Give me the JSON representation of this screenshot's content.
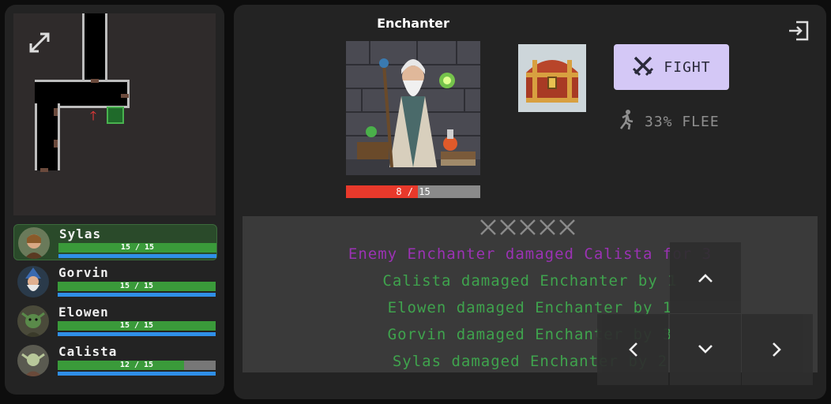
{
  "map": {
    "expand_icon": "expand-arrows-icon",
    "player_icon": "red-arrow-up-icon",
    "exit_icon": "green-square-icon"
  },
  "party": [
    {
      "name": "Sylas",
      "hp": 15,
      "max_hp": 15,
      "hp_text": "15 / 15",
      "active": true,
      "avatar": "elf-ranger"
    },
    {
      "name": "Gorvin",
      "hp": 15,
      "max_hp": 15,
      "hp_text": "15 / 15",
      "active": false,
      "avatar": "gnome-wizard"
    },
    {
      "name": "Elowen",
      "hp": 15,
      "max_hp": 15,
      "hp_text": "15 / 15",
      "active": false,
      "avatar": "lizardfolk"
    },
    {
      "name": "Calista",
      "hp": 12,
      "max_hp": 15,
      "hp_text": "12 / 15",
      "active": false,
      "avatar": "elf-cleric"
    }
  ],
  "enemy": {
    "name": "Enchanter",
    "hp": 8,
    "max_hp": 15,
    "hp_current": "8",
    "hp_sep": " / ",
    "hp_max": "15",
    "portrait": "old-wizard-with-potions"
  },
  "loot": {
    "icon": "treasure-chest-icon"
  },
  "actions": {
    "fight_label": "FIGHT",
    "fight_icon": "crossed-swords-icon",
    "flee_label": "33% FLEE",
    "flee_icon": "running-person-icon",
    "exit_icon": "exit-door-icon"
  },
  "log": {
    "turn_icons": "crossed-swords-icon x5",
    "lines": [
      {
        "text": "Enemy Enchanter damaged Calista for 3",
        "color": "#9b32b4"
      },
      {
        "text": "Calista damaged Enchanter by 1",
        "color": "#3fa34d"
      },
      {
        "text": "Elowen damaged Enchanter by 1",
        "color": "#3fa34d"
      },
      {
        "text": "Gorvin damaged Enchanter by 3",
        "color": "#3fa34d"
      },
      {
        "text": "Sylas damaged Enchanter by 2",
        "color": "#3fa34d"
      }
    ]
  },
  "dpad": {
    "up": "chevron-up-icon",
    "left": "chevron-left-icon",
    "down": "chevron-down-icon",
    "right": "chevron-right-icon"
  },
  "colors": {
    "hp": "#3a9a3a",
    "mp": "#2f8fe8",
    "enemy_hp": "#e8392b",
    "fight_bg": "#d4c8f6"
  }
}
